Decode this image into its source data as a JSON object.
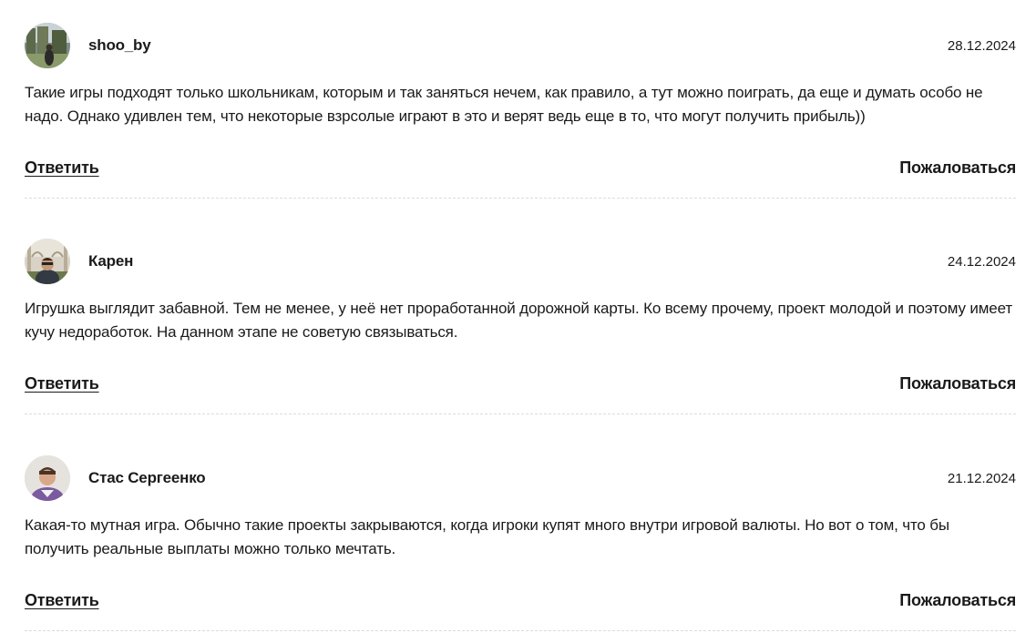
{
  "comments": [
    {
      "author": "shoo_by",
      "date": "28.12.2024",
      "text": "Такие игры подходят только школьникам, которым и так заняться нечем, как правило, а тут можно поиграть, да еще и думать особо не надо. Однако удивлен тем, что некоторые взрсолые играют в это и верят ведь еще в то, что могут получить прибыль))",
      "reply_label": "Ответить",
      "report_label": "Пожаловаться"
    },
    {
      "author": "Карен",
      "date": "24.12.2024",
      "text": "Игрушка выглядит забавной. Тем не менее, у неё нет проработанной дорожной карты. Ко всему прочему, проект молодой и поэтому имеет кучу недоработок. На данном этапе не советую связываться.",
      "reply_label": "Ответить",
      "report_label": "Пожаловаться"
    },
    {
      "author": "Стас Сергеенко",
      "date": "21.12.2024",
      "text": "Какая-то мутная игра. Обычно такие проекты закрываются, когда игроки купят много внутри игровой валюты. Но вот о том, что бы получить реальные выплаты можно только мечтать.",
      "reply_label": "Ответить",
      "report_label": "Пожаловаться"
    }
  ],
  "colors": {
    "text": "#1a1a1a",
    "divider": "#dcdcdc",
    "background": "#ffffff"
  }
}
